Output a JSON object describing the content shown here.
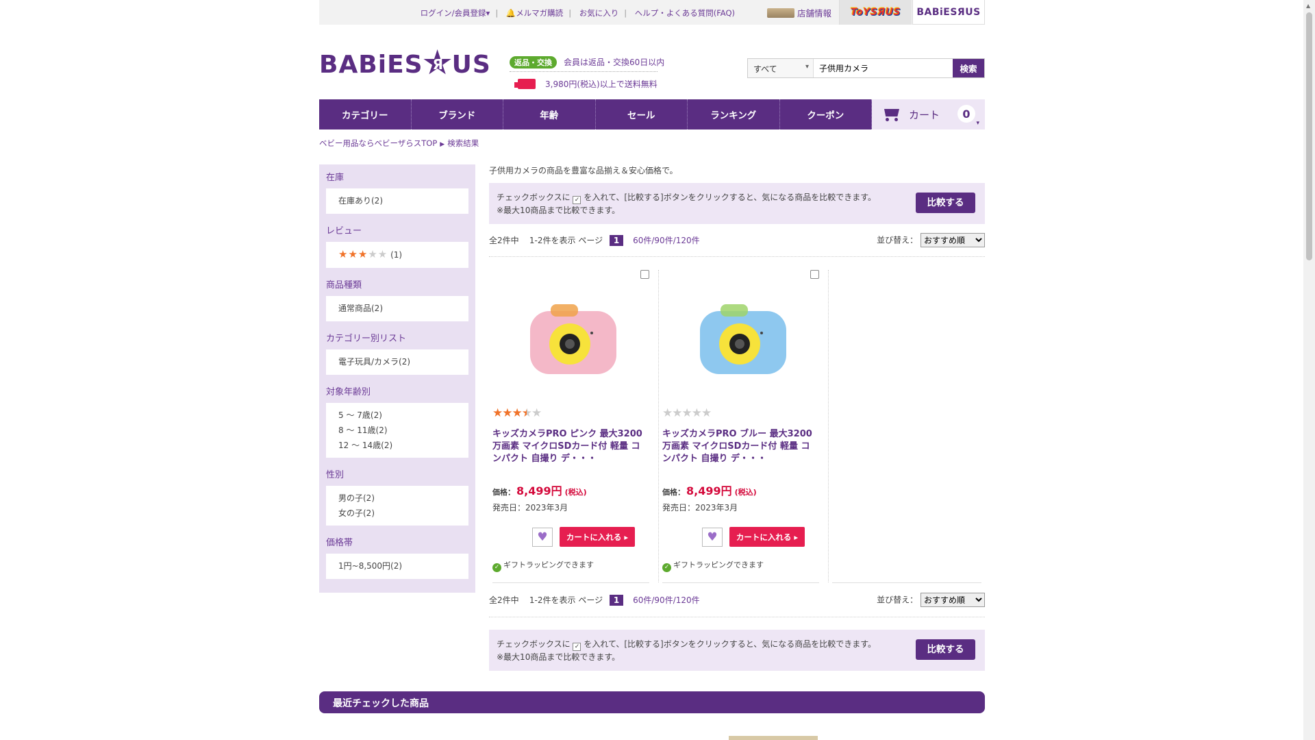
{
  "topbar": {
    "links": [
      "ログイン/会員登録▾",
      "メルマガ購読",
      "お気に入り",
      "ヘルプ・よくある質問(FAQ)"
    ],
    "store_info": "店舗情報",
    "toys_tab": "ToYSЯUS",
    "babies_tab": "BABiESЯUS"
  },
  "header": {
    "logo": "BABiES",
    "logo_star": "Я",
    "logo_tail": "US",
    "return_badge": "返品・交換",
    "return_text": "会員は返品・交換60日以内",
    "shipping_text": "3,980円(税込)以上で送料無料"
  },
  "search": {
    "category": "すべて",
    "query": "子供用カメラ",
    "button": "検索"
  },
  "nav": {
    "items": [
      "カテゴリー",
      "ブランド",
      "年齢",
      "セール",
      "ランキング",
      "クーポン"
    ],
    "cart_label": "カート",
    "cart_count": "0"
  },
  "breadcrumb": {
    "home": "ベビー用品ならベビーザらスTOP",
    "current": "検索結果"
  },
  "sidebar": {
    "groups": [
      {
        "title": "在庫",
        "options": [
          "在庫あり(2)"
        ]
      },
      {
        "title": "レビュー",
        "options": [
          "(1)"
        ]
      },
      {
        "title": "商品種類",
        "options": [
          "通常商品(2)"
        ]
      },
      {
        "title": "カテゴリー別リスト",
        "options": [
          "電子玩具/カメラ(2)"
        ]
      },
      {
        "title": "対象年齢別",
        "options": [
          "5 ～ 7歳(2)",
          "8 ～ 11歳(2)",
          "12 ～ 14歳(2)"
        ]
      },
      {
        "title": "性別",
        "options": [
          "男の子(2)",
          "女の子(2)"
        ]
      },
      {
        "title": "価格帯",
        "options": [
          "1円~8,500円(2)"
        ]
      }
    ],
    "review_stars": 3
  },
  "main": {
    "intro": "子供用カメラの商品を豊富な品揃え＆安心価格で。",
    "compare_line1_a": "チェックボックスに",
    "compare_line1_b": "を入れて、[比較する]ボタンをクリックすると、気になる商品を比較できます。",
    "compare_line2": "※最大10商品まで比較できます。",
    "compare_button": "比較する",
    "pager": {
      "total": "全2件中",
      "range": "1-2件を表示 ページ",
      "current_page": "1",
      "per_page": "60件/90件/120件",
      "sort_label": "並び替え：",
      "sort_value": "おすすめ順"
    }
  },
  "products": [
    {
      "name": "キッズカメラPRO ピンク 最大3200万画素 マイクロSDカード付 軽量 コンパクト 自撮り デ・・・",
      "price_label": "価格：",
      "price": "8,499円",
      "tax": "(税込)",
      "release": "発売日：2023年3月",
      "add_to_cart": "カートに入れる ▸",
      "gift": "ギフトラッピングできます",
      "rating": 3.5,
      "color": "#f4b8c8"
    },
    {
      "name": "キッズカメラPRO ブルー 最大3200万画素 マイクロSDカード付 軽量 コンパクト 自撮り デ・・・",
      "price_label": "価格：",
      "price": "8,499円",
      "tax": "(税込)",
      "release": "発売日：2023年3月",
      "add_to_cart": "カートに入れる ▸",
      "gift": "ギフトラッピングできます",
      "rating": 0,
      "color": "#8ec8ef"
    }
  ],
  "recent": {
    "title": "最近チェックした商品"
  }
}
